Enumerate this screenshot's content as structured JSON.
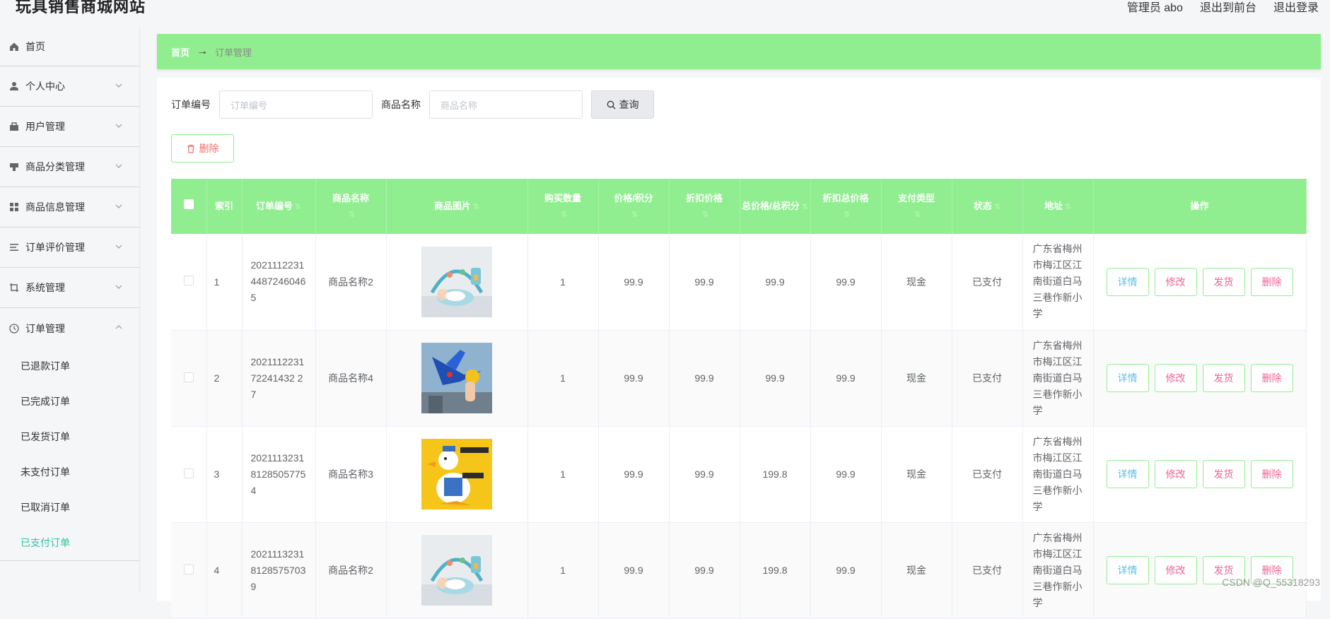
{
  "header": {
    "site_title": "玩具销售商城网站",
    "admin_label": "管理员 abo",
    "front_link": "退出到前台",
    "logout_link": "退出登录"
  },
  "sidebar": {
    "items": [
      {
        "label": "首页",
        "icon": "home-icon"
      },
      {
        "label": "个人中心",
        "icon": "user-icon"
      },
      {
        "label": "用户管理",
        "icon": "briefcase-icon"
      },
      {
        "label": "商品分类管理",
        "icon": "tag-icon"
      },
      {
        "label": "商品信息管理",
        "icon": "grid-icon"
      },
      {
        "label": "订单评价管理",
        "icon": "list-icon"
      },
      {
        "label": "系统管理",
        "icon": "crop-icon"
      },
      {
        "label": "订单管理",
        "icon": "clock-icon"
      }
    ],
    "sub_items": [
      "已退款订单",
      "已完成订单",
      "已发货订单",
      "未支付订单",
      "已取消订单",
      "已支付订单"
    ],
    "active_sub": "已支付订单"
  },
  "breadcrumb": {
    "home": "首页",
    "arrow": "→",
    "current": "订单管理"
  },
  "search": {
    "order_no_label": "订单编号",
    "order_no_placeholder": "订单编号",
    "product_name_label": "商品名称",
    "product_name_placeholder": "商品名称",
    "query_button": "查询"
  },
  "actions": {
    "delete_button": "删除"
  },
  "table": {
    "columns": [
      "索引",
      "订单编号",
      "商品名称",
      "商品图片",
      "购买数量",
      "价格/积分",
      "折扣价格",
      "总价格/总积分",
      "折扣总价格",
      "支付类型",
      "状态",
      "地址",
      "操作"
    ],
    "rows": [
      {
        "index": "1",
        "order_no": "202111223144872460465",
        "product": "商品名称2",
        "image": "baby-gym-toy",
        "qty": "1",
        "price": "99.9",
        "discount": "99.9",
        "total": "99.9",
        "discount_total": "99.9",
        "pay_type": "现金",
        "status": "已支付",
        "address": "广东省梅州市梅江区江南街道白马三巷作新小学"
      },
      {
        "index": "2",
        "order_no": "202111223172241432 27",
        "product": "商品名称4",
        "image": "airplane-toy-gun",
        "qty": "1",
        "price": "99.9",
        "discount": "99.9",
        "total": "99.9",
        "discount_total": "99.9",
        "pay_type": "现金",
        "status": "已支付",
        "address": "广东省梅州市梅江区江南街道白马三巷作新小学"
      },
      {
        "index": "3",
        "order_no": "202111323181285057754",
        "product": "商品名称3",
        "image": "duck-plush-toy",
        "qty": "1",
        "price": "99.9",
        "discount": "99.9",
        "total": "199.8",
        "discount_total": "99.9",
        "pay_type": "现金",
        "status": "已支付",
        "address": "广东省梅州市梅江区江南街道白马三巷作新小学"
      },
      {
        "index": "4",
        "order_no": "202111323181285757039",
        "product": "商品名称2",
        "image": "baby-gym-toy",
        "qty": "1",
        "price": "99.9",
        "discount": "99.9",
        "total": "199.8",
        "discount_total": "99.9",
        "pay_type": "现金",
        "status": "已支付",
        "address": "广东省梅州市梅江区江南街道白马三巷作新小学"
      }
    ],
    "op_labels": {
      "detail": "详情",
      "edit": "修改",
      "ship": "发货",
      "delete": "删除"
    }
  },
  "watermark": "CSDN @Q_55318293",
  "colors": {
    "accent_green": "#90ee90",
    "active_teal": "#2fc3a0",
    "danger": "#f56c6c"
  }
}
